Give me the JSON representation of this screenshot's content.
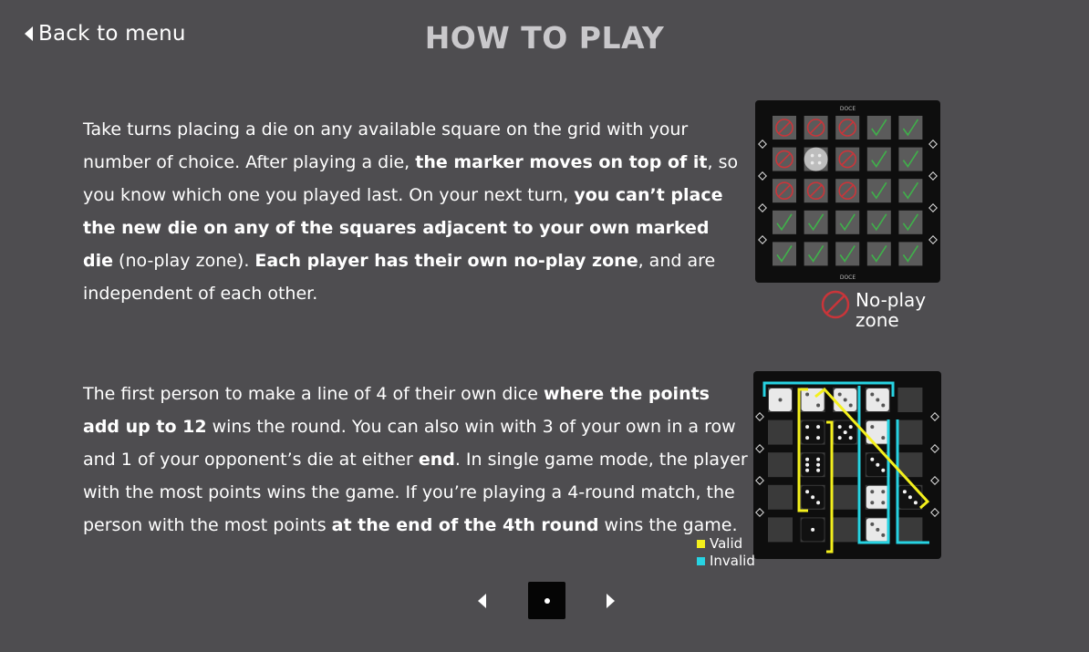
{
  "header": {
    "back_label": "Back to menu",
    "title": "HOW TO PLAY"
  },
  "section1": {
    "segments": [
      {
        "text": "Take turns placing a die on any available square on the grid with your number of  choice. After playing a die, ",
        "bold": false
      },
      {
        "text": "the marker moves on top of it",
        "bold": true
      },
      {
        "text": ", so you know which one you played last. On your next turn, ",
        "bold": false
      },
      {
        "text": "you can’t place the new die on any of the squares adjacent to your own marked die",
        "bold": true
      },
      {
        "text": " (no-play zone). ",
        "bold": false
      },
      {
        "text": "Each player has their own no-play zone",
        "bold": true
      },
      {
        "text": ", and are independent of each other.",
        "bold": false
      }
    ],
    "board": {
      "grid_top_label": "DOCE",
      "grid_bottom_label": "DOCE",
      "cells": [
        [
          "no",
          "no",
          "no",
          "ok",
          "ok"
        ],
        [
          "no",
          "marker",
          "no",
          "ok",
          "ok"
        ],
        [
          "no",
          "no",
          "no",
          "ok",
          "ok"
        ],
        [
          "ok",
          "ok",
          "ok",
          "ok",
          "ok"
        ],
        [
          "ok",
          "ok",
          "ok",
          "ok",
          "ok"
        ]
      ]
    },
    "legend_label": "No-play zone"
  },
  "section2": {
    "segments": [
      {
        "text": "The first person to make a line of 4 of their own dice ",
        "bold": false
      },
      {
        "text": "where the points add up to  12",
        "bold": true
      },
      {
        "text": " wins the round. You can also win with 3 of your own in a row and 1 of your opponent’s die at either ",
        "bold": false
      },
      {
        "text": "end",
        "bold": true
      },
      {
        "text": ". In single game mode, the player with the most points wins the game. If you’re playing a 4-round match, the person with the most points ",
        "bold": false
      },
      {
        "text": "at the end of the 4th round",
        "bold": true
      },
      {
        "text": " wins the game.",
        "bold": false
      }
    ],
    "board": {
      "dice": [
        {
          "row": 0,
          "col": 0,
          "pips": 1,
          "color": "white"
        },
        {
          "row": 0,
          "col": 1,
          "pips": 2,
          "color": "white"
        },
        {
          "row": 0,
          "col": 2,
          "pips": 3,
          "color": "white"
        },
        {
          "row": 0,
          "col": 3,
          "pips": 3,
          "color": "white"
        },
        {
          "row": 1,
          "col": 1,
          "pips": 4,
          "color": "black"
        },
        {
          "row": 1,
          "col": 2,
          "pips": 5,
          "color": "black"
        },
        {
          "row": 1,
          "col": 3,
          "pips": 2,
          "color": "white"
        },
        {
          "row": 2,
          "col": 1,
          "pips": 6,
          "color": "black"
        },
        {
          "row": 2,
          "col": 3,
          "pips": 3,
          "color": "black"
        },
        {
          "row": 3,
          "col": 1,
          "pips": 3,
          "color": "black"
        },
        {
          "row": 3,
          "col": 3,
          "pips": 4,
          "color": "white"
        },
        {
          "row": 3,
          "col": 4,
          "pips": 3,
          "color": "black"
        },
        {
          "row": 4,
          "col": 1,
          "pips": 1,
          "color": "black"
        },
        {
          "row": 4,
          "col": 3,
          "pips": 3,
          "color": "white"
        }
      ]
    },
    "legend": [
      {
        "label": "Valid",
        "color": "#f4f01c"
      },
      {
        "label": "Invalid",
        "color": "#27d3e2"
      }
    ]
  },
  "pager": {
    "current_page": 1
  },
  "colors": {
    "background": "#4e4d50",
    "title": "#c9c8cb",
    "noplay": "#c9353a",
    "valid_check": "#3fb14a",
    "valid": "#f4f01c",
    "invalid": "#27d3e2"
  }
}
